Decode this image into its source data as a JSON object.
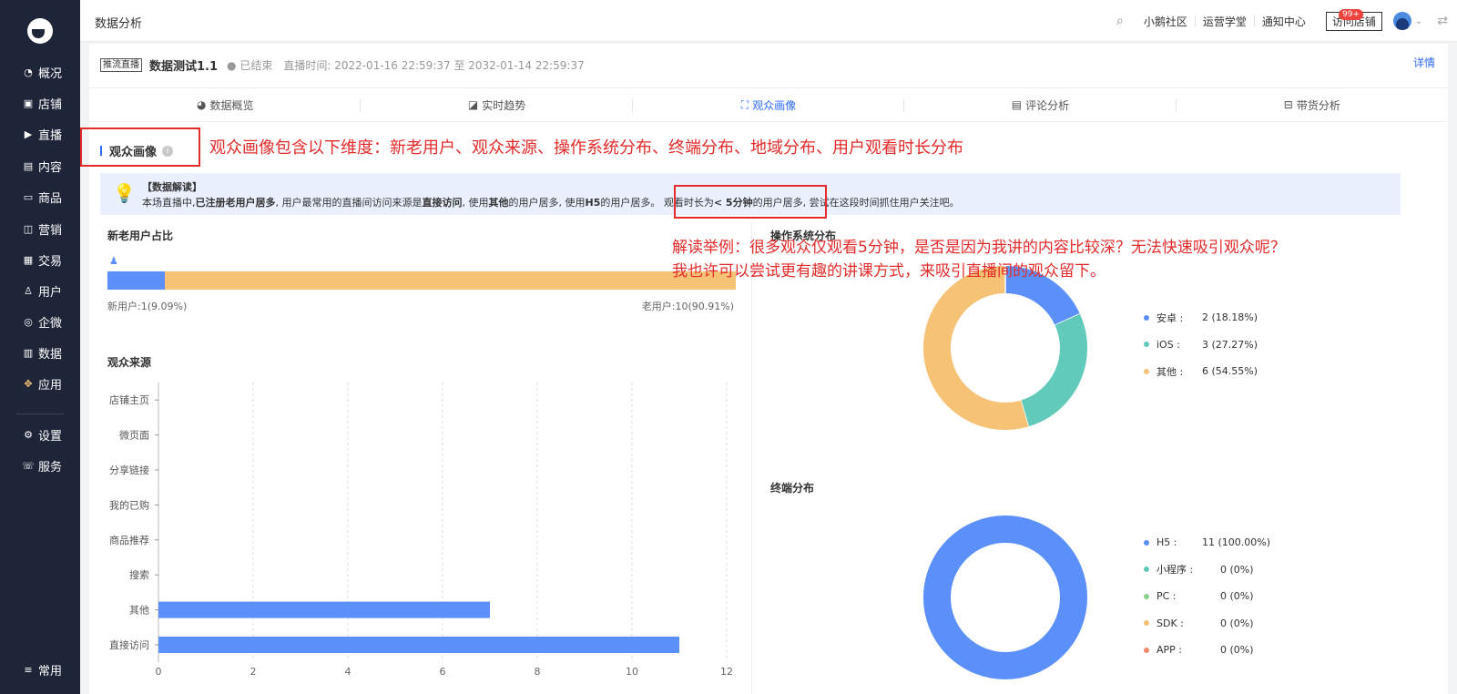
{
  "sidebar": {
    "items": [
      {
        "label": "概况",
        "icon": "clock-icon"
      },
      {
        "label": "店铺",
        "icon": "store-icon"
      },
      {
        "label": "直播",
        "icon": "live-icon"
      },
      {
        "label": "内容",
        "icon": "document-icon"
      },
      {
        "label": "商品",
        "icon": "goods-icon"
      },
      {
        "label": "营销",
        "icon": "megaphone-icon"
      },
      {
        "label": "交易",
        "icon": "trade-icon"
      },
      {
        "label": "用户",
        "icon": "user-icon"
      },
      {
        "label": "企微",
        "icon": "wecom-icon"
      },
      {
        "label": "数据",
        "icon": "chart-icon"
      },
      {
        "label": "应用",
        "icon": "apps-icon"
      },
      {
        "label": "设置",
        "icon": "gear-icon"
      },
      {
        "label": "服务",
        "icon": "service-icon"
      },
      {
        "label": "常用",
        "icon": "list-icon"
      }
    ]
  },
  "header": {
    "title": "数据分析",
    "links": [
      "小鹅社区",
      "运营学堂",
      "通知中心"
    ],
    "badge": "99+",
    "visit_button": "访问店铺"
  },
  "live": {
    "tag": "推流直播",
    "title": "数据测试1.1",
    "status": "● 已结束",
    "time": "直播时间: 2022-01-16 22:59:37 至 2032-01-14 22:59:37",
    "detail": "详情"
  },
  "tabs": [
    {
      "label": "数据概览",
      "icon": "pie-icon"
    },
    {
      "label": "实时趋势",
      "icon": "trend-icon"
    },
    {
      "label": "观众画像",
      "icon": "portrait-icon"
    },
    {
      "label": "评论分析",
      "icon": "comment-icon"
    },
    {
      "label": "带货分析",
      "icon": "basket-icon"
    }
  ],
  "section": {
    "title": "观众画像",
    "info": "i"
  },
  "annotations": {
    "a1": "观众画像包含以下维度：新老用户、观众来源、操作系统分布、终端分布、地域分布、用户观看时长分布",
    "a2_line1": "解读举例：很多观众仅观看5分钟，是否是因为我讲的内容比较深？无法快速吸引观众呢？",
    "a2_line2": "我也许可以尝试更有趣的讲课方式，来吸引直播间的观众留下。"
  },
  "interpretation": {
    "title": "【数据解读】",
    "p1": "本场直播中,",
    "b1": "已注册老用户居多",
    "p2": ", 用户最常用的直播间访问来源是",
    "b2": "直接访问",
    "p3": ", 使用",
    "b3": "其他",
    "p4": "的用户居多, 使用",
    "b4": "H5",
    "p5": "的用户居多。 观看时长为",
    "b5": "< 5分钟",
    "p6": "的用户居多, 尝试在这段时间抓住用户关注吧。"
  },
  "new_old": {
    "title": "新老用户占比",
    "new_label": "新用户:1(9.09%)",
    "old_label": "老用户:10(90.91%)",
    "new_fraction": 0.0909,
    "colors": {
      "new": "#5b8ff9",
      "old": "#f6c275"
    }
  },
  "source": {
    "title": "观众来源"
  },
  "os": {
    "title": "操作系统分布",
    "legend": [
      {
        "name": "安卓 :",
        "value": "2 (18.18%)",
        "color": "#5b8ff9"
      },
      {
        "name": "iOS :",
        "value": "3 (27.27%)",
        "color": "#62caba"
      },
      {
        "name": "其他 :",
        "value": "6 (54.55%)",
        "color": "#f6c275"
      }
    ]
  },
  "terminal": {
    "title": "终端分布",
    "legend": [
      {
        "name": "H5 :",
        "value": "11 (100.00%)",
        "color": "#5b8ff9"
      },
      {
        "name": "小程序 :",
        "value": "0 (0%)",
        "color": "#62caba"
      },
      {
        "name": "PC :",
        "value": "0 (0%)",
        "color": "#8bd18b"
      },
      {
        "name": "SDK :",
        "value": "0 (0%)",
        "color": "#f6c275"
      },
      {
        "name": "APP :",
        "value": "0 (0%)",
        "color": "#f08a6a"
      }
    ]
  },
  "chart_data": [
    {
      "type": "bar",
      "title": "观众来源",
      "orientation": "horizontal",
      "categories": [
        "店铺主页",
        "微页面",
        "分享链接",
        "我的已购",
        "商品推荐",
        "搜索",
        "其他",
        "直接访问"
      ],
      "values": [
        0,
        0,
        0,
        0,
        0,
        0,
        7,
        11
      ],
      "xlim": [
        0,
        12
      ],
      "xticks": [
        0,
        2,
        4,
        6,
        8,
        10,
        12
      ],
      "grid": true,
      "color": "#5b8ff9"
    },
    {
      "type": "pie",
      "title": "操作系统分布",
      "categories": [
        "安卓",
        "iOS",
        "其他"
      ],
      "values": [
        2,
        3,
        6
      ],
      "colors": [
        "#5b8ff9",
        "#62caba",
        "#f6c275"
      ],
      "donut": true
    },
    {
      "type": "pie",
      "title": "终端分布",
      "categories": [
        "H5",
        "小程序",
        "PC",
        "SDK",
        "APP"
      ],
      "values": [
        11,
        0,
        0,
        0,
        0
      ],
      "colors": [
        "#5b8ff9",
        "#62caba",
        "#8bd18b",
        "#f6c275",
        "#f08a6a"
      ],
      "donut": true
    }
  ]
}
